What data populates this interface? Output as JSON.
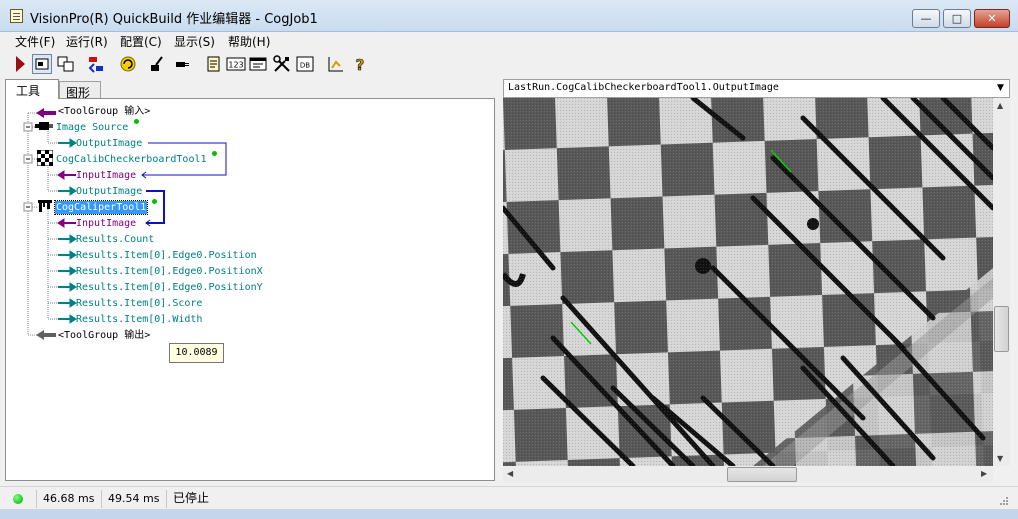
{
  "window": {
    "title": "VisionPro(R) QuickBuild 作业编辑器 - CogJob1",
    "minimize": "—",
    "maximize": "□",
    "close": "✕"
  },
  "menu": [
    "文件(F)",
    "运行(R)",
    "配置(C)",
    "显示(S)",
    "帮助(H)"
  ],
  "toolbar": {
    "icons": [
      "run-icon",
      "layout-icon",
      "edit-icon",
      "record-icon",
      "refresh-icon",
      "brush-icon",
      "plug-icon",
      "notepad-icon",
      "counter-icon",
      "window-icon",
      "tools-icon",
      "db-icon",
      "chart-icon",
      "help-icon"
    ],
    "counter_text": "123",
    "db_text": "DB"
  },
  "left_tabs": [
    "工具",
    "图形"
  ],
  "tree": {
    "input_group": "<ToolGroup 输入>",
    "image_source": "Image Source",
    "output_image_1": "OutputImage",
    "calib_tool": "CogCalibCheckerboardTool1",
    "calib_input": "InputImage",
    "calib_output": "OutputImage",
    "caliper_tool": "CogCaliperTool1",
    "caliper_input": "InputImage",
    "results": [
      "Results.Count",
      "Results.Item[0].Edge0.Position",
      "Results.Item[0].Edge0.PositionX",
      "Results.Item[0].Edge0.PositionY",
      "Results.Item[0].Score",
      "Results.Item[0].Width"
    ],
    "output_group": "<ToolGroup 输出>",
    "tooltip": "10.0089"
  },
  "display": {
    "selected": "LastRun.CogCalibCheckerboardTool1.OutputImage"
  },
  "status": {
    "time1": "46.68 ms",
    "time2": "49.54 ms",
    "state": "已停止"
  },
  "colors": {
    "teal": "#008080",
    "purple": "#800080",
    "link_blue": "#1010c0",
    "selection": "#3399ff",
    "status_ok": "#00c000"
  }
}
